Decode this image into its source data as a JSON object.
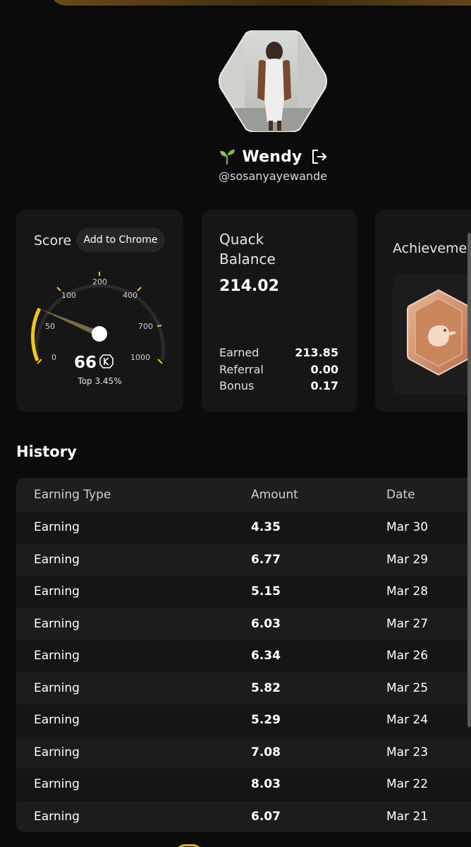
{
  "profile": {
    "name": "Wendy",
    "handle": "@sosanyayewande"
  },
  "score": {
    "title": "Score",
    "add_to_chrome": "Add to Chrome",
    "value": "66",
    "rank": "Top 3.45%",
    "gauge_ticks": [
      "0",
      "50",
      "100",
      "200",
      "400",
      "700",
      "1000"
    ]
  },
  "quack": {
    "title": "Quack Balance",
    "balance": "214.02",
    "rows": [
      {
        "label": "Earned",
        "value": "213.85"
      },
      {
        "label": "Referral",
        "value": "0.00"
      },
      {
        "label": "Bonus",
        "value": "0.17"
      }
    ]
  },
  "achievements": {
    "title": "Achievements",
    "badge": "duck-badge-icon"
  },
  "history": {
    "title": "History",
    "columns": [
      "Earning Type",
      "Amount",
      "Date"
    ],
    "rows": [
      {
        "type": "Earning",
        "amount": "4.35",
        "date": "Mar 30"
      },
      {
        "type": "Earning",
        "amount": "6.77",
        "date": "Mar 29"
      },
      {
        "type": "Earning",
        "amount": "5.15",
        "date": "Mar 28"
      },
      {
        "type": "Earning",
        "amount": "6.03",
        "date": "Mar 27"
      },
      {
        "type": "Earning",
        "amount": "6.34",
        "date": "Mar 26"
      },
      {
        "type": "Earning",
        "amount": "5.82",
        "date": "Mar 25"
      },
      {
        "type": "Earning",
        "amount": "5.29",
        "date": "Mar 24"
      },
      {
        "type": "Earning",
        "amount": "7.08",
        "date": "Mar 23"
      },
      {
        "type": "Earning",
        "amount": "8.03",
        "date": "Mar 22"
      },
      {
        "type": "Earning",
        "amount": "6.07",
        "date": "Mar 21"
      }
    ]
  },
  "colors": {
    "background": "#0b0b0b",
    "card": "#161616",
    "accent": "#f5c518",
    "badge": "#c98e6a"
  }
}
